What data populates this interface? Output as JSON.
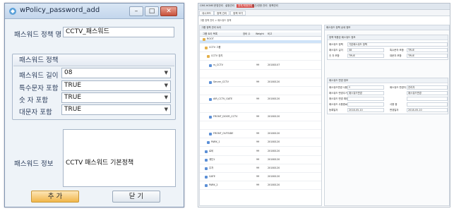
{
  "dialog": {
    "title": "wPolicy_password_add",
    "policy_name_label": "패스워드 정책 명",
    "policy_name_value": "CCTV_패스워드",
    "group_title": "패스워드 정책",
    "fields": [
      {
        "label": "패스워드 길이",
        "value": "08"
      },
      {
        "label": "특수문자 포함",
        "value": "TRUE"
      },
      {
        "label": "숫 자  포함",
        "value": "TRUE"
      },
      {
        "label": "대문자  포함",
        "value": "TRUE"
      }
    ],
    "info_label": "패스워드 정보",
    "info_value": "CCTV 패스워드 기본정책",
    "add_button": "추 가",
    "close_button": "닫 기",
    "window_buttons": {
      "minimize": "–",
      "maximize": "□",
      "close": "✕"
    }
  },
  "app": {
    "menu": [
      "CMS HOME",
      "운영관리",
      "설정관리",
      "장치/계정관리",
      "접근/권한 관리",
      "정책관리"
    ],
    "tabs": [
      {
        "label": "대시보드"
      },
      {
        "label": "정책 관리"
      },
      {
        "label": "정책 보기"
      }
    ],
    "breadcrumb": "그룹 정책 관리 > 패스워드 정책",
    "left_panel": {
      "title": "그룹 정책 관리 트리",
      "columns": [
        "그룹 트리 목록",
        "장비 수",
        "Weight",
        "비고"
      ],
      "rows": [
        {
          "name": "ROOT",
          "count": "",
          "weight": "",
          "note": ""
        },
        {
          "name": "CCTV 그룹",
          "count": "",
          "weight": "",
          "note": ""
        },
        {
          "name": "CCTV 장치",
          "count": "",
          "weight": "",
          "note": ""
        },
        {
          "name": "rs_CCTV",
          "count": "",
          "weight": "99",
          "note": "20180107"
        },
        {
          "name": "",
          "count": "",
          "weight": "",
          "note": ""
        },
        {
          "name": "Server_CCTV",
          "count": "",
          "weight": "99",
          "note": "20180120"
        },
        {
          "name": "",
          "count": "",
          "weight": "",
          "note": ""
        },
        {
          "name": "AIR_CCTV_GATE",
          "count": "",
          "weight": "99",
          "note": "20180120"
        },
        {
          "name": "",
          "count": "",
          "weight": "",
          "note": ""
        },
        {
          "name": "FRONT_DOOR_CCTV",
          "count": "",
          "weight": "99",
          "note": "20180120"
        },
        {
          "name": "",
          "count": "",
          "weight": "",
          "note": ""
        },
        {
          "name": "FRONT_OUTSIDE",
          "count": "",
          "weight": "99",
          "note": "20180120"
        },
        {
          "name": "PARK_1",
          "count": "",
          "weight": "99",
          "note": "20180120"
        },
        {
          "name": "로비",
          "count": "",
          "weight": "99",
          "note": "20180120"
        },
        {
          "name": "계단1",
          "count": "",
          "weight": "99",
          "note": "20180120"
        },
        {
          "name": "주차",
          "count": "",
          "weight": "99",
          "note": "20180120"
        },
        {
          "name": "GATE",
          "count": "",
          "weight": "99",
          "note": "20180120"
        },
        {
          "name": "PARK_2",
          "count": "",
          "weight": "99",
          "note": "20180120"
        }
      ]
    },
    "right_panel": {
      "title": "패스워드 정책 상세 정보",
      "section1_title": "정책 적용된 패스워드 정보",
      "section1_rows": [
        {
          "label": "패스워드 정책",
          "value": "기본패스워드 정책"
        },
        {
          "label": "패스워드 길이",
          "value": "08",
          "label2": "특수문자 포함",
          "value2": "TRUE"
        },
        {
          "label": "숫 자 포함",
          "value": "TRUE",
          "label2": "대문자 포함",
          "value2": "TRUE"
        }
      ],
      "section2_title": "패스워드 변경 정보",
      "section2_rows": [
        {
          "label": "패스워드변경 사용",
          "value": "Y",
          "label2": "패스워드 변경자",
          "value2": "관리자"
        },
        {
          "label": "패스워드 변경주기",
          "value": "패스워드변경",
          "label2": "",
          "value2": "패스워드변경"
        },
        {
          "label": "패스워드 변경 예정일",
          "value": "",
          "label2": "",
          "value2": ""
        },
        {
          "label": "패스워드 사용종료",
          "value": "",
          "label2": "사용 중",
          "value2": ""
        },
        {
          "label": "등록일자",
          "value": "2018-05-10",
          "label2": "변경일자",
          "value2": "2018-05-10"
        }
      ]
    }
  }
}
